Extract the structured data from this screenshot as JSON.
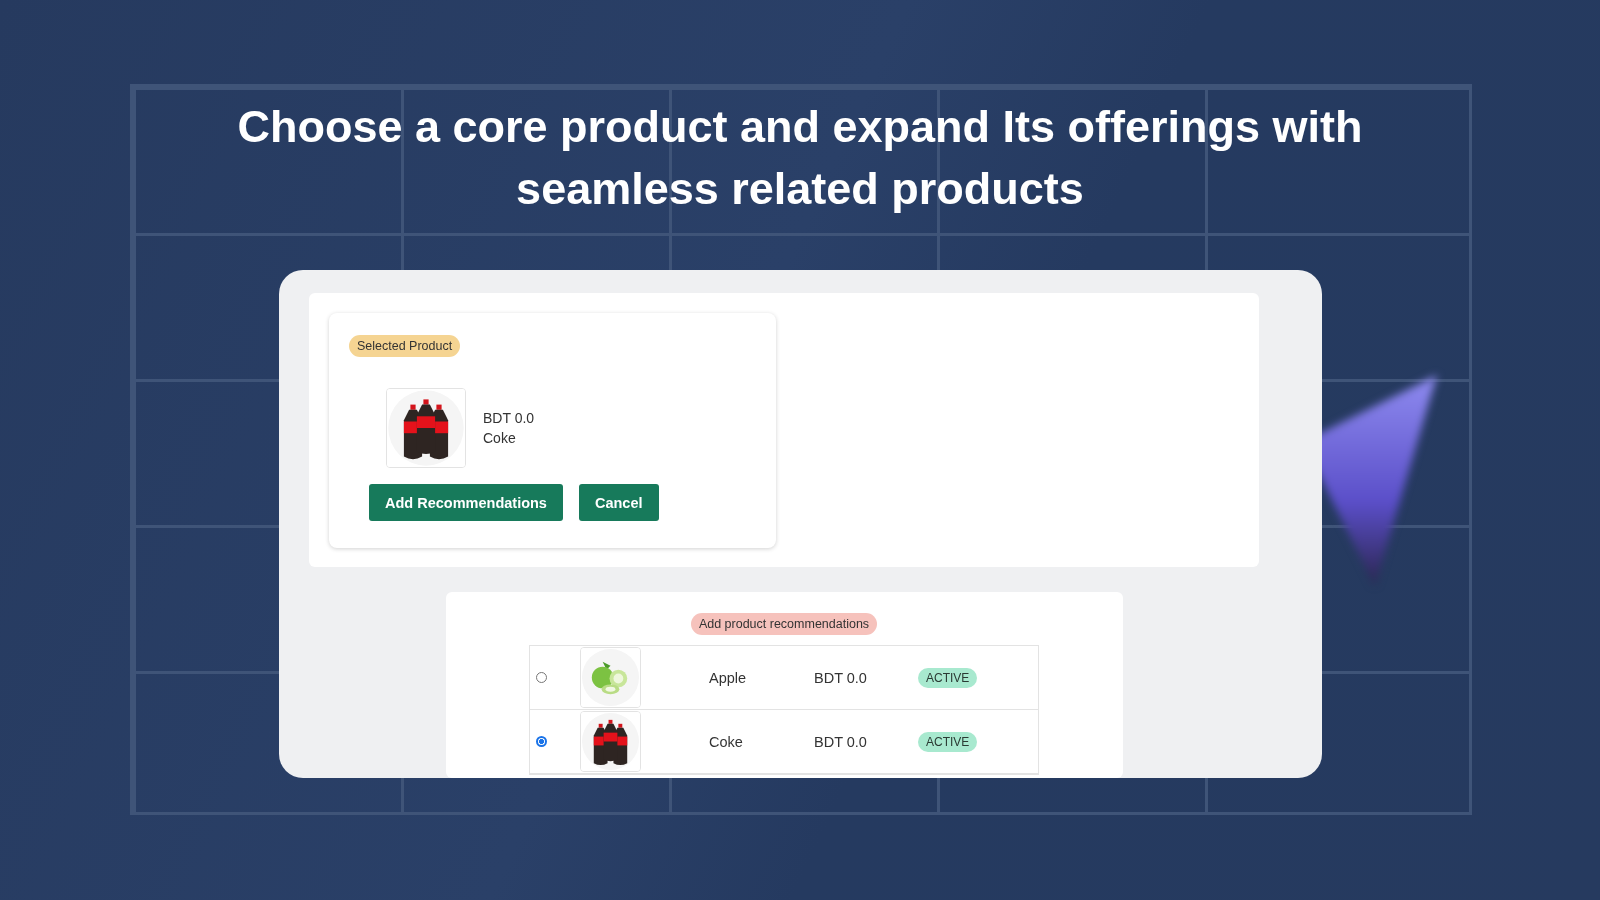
{
  "headline": "Choose a core product and expand Its offerings with seamless related products",
  "selected_panel": {
    "badge": "Selected Product",
    "product": {
      "price": "BDT 0.0",
      "name": "Coke"
    },
    "buttons": [
      "Add Recommendations",
      "Cancel"
    ]
  },
  "recommendations": {
    "badge": "Add product recommendations",
    "rows": [
      {
        "selected": false,
        "name": "Apple",
        "price": "BDT 0.0",
        "status": "ACTIVE"
      },
      {
        "selected": true,
        "name": "Coke",
        "price": "BDT 0.0",
        "status": "ACTIVE"
      }
    ]
  }
}
